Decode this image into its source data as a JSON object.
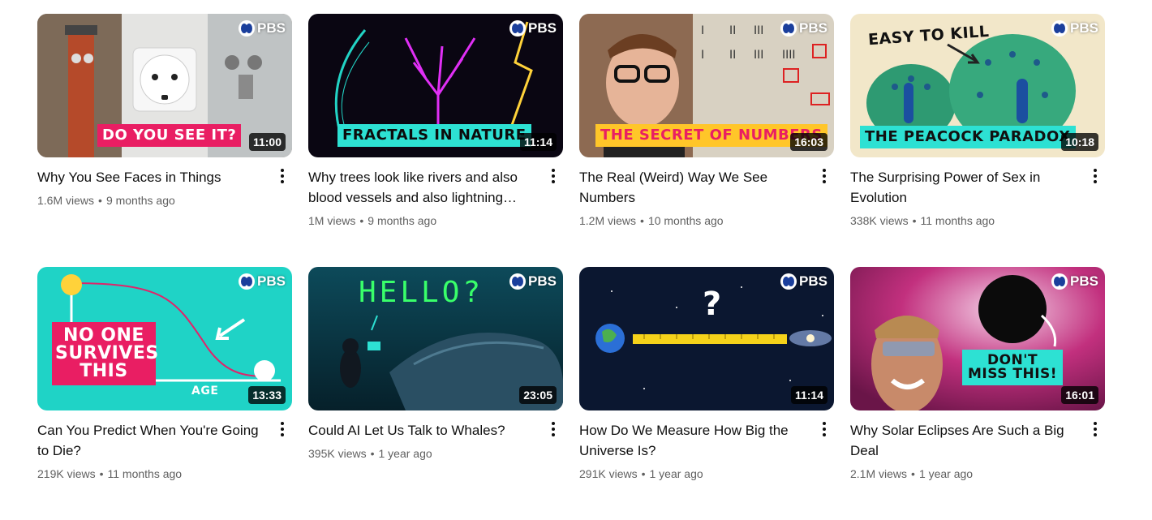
{
  "channel_badge": "PBS",
  "videos": [
    {
      "caption": "DO YOU SEE IT?",
      "duration": "11:00",
      "title": "Why You See Faces in Things",
      "views": "1.6M views",
      "age": "9 months ago"
    },
    {
      "caption": "FRACTALS IN NATURE",
      "duration": "11:14",
      "title": "Why trees look like rivers and also blood vessels and also lightning…",
      "views": "1M views",
      "age": "9 months ago"
    },
    {
      "caption": "THE SECRET OF NUMBERS",
      "duration": "16:03",
      "title": "The Real (Weird) Way We See Numbers",
      "views": "1.2M views",
      "age": "10 months ago"
    },
    {
      "caption": "THE PEACOCK PARADOX",
      "caption2": "EASY TO KILL",
      "duration": "10:18",
      "title": "The Surprising Power of Sex in Evolution",
      "views": "338K views",
      "age": "11 months ago"
    },
    {
      "caption": "NO ONE SURVIVES THIS",
      "caption2": "AGE",
      "duration": "13:33",
      "title": "Can You Predict When You're Going to Die?",
      "views": "219K views",
      "age": "11 months ago"
    },
    {
      "caption": "HELLO?",
      "duration": "23:05",
      "title": "Could AI Let Us Talk to Whales?",
      "views": "395K views",
      "age": "1 year ago"
    },
    {
      "caption": "?",
      "duration": "11:14",
      "title": "How Do We Measure How Big the Universe Is?",
      "views": "291K views",
      "age": "1 year ago"
    },
    {
      "caption": "DON'T MISS THIS!",
      "duration": "16:01",
      "title": "Why Solar Eclipses Are Such a Big Deal",
      "views": "2.1M views",
      "age": "1 year ago"
    }
  ]
}
